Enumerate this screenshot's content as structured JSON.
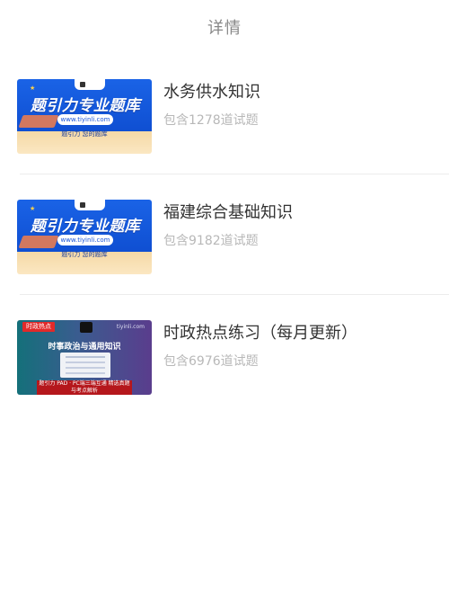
{
  "header": {
    "title": "详情"
  },
  "items": [
    {
      "name": "水务供水知识",
      "count": "包含1278道试题",
      "thumb": {
        "type": "blue",
        "banner": "题引力专业题库",
        "url": "www.tiyinli.com",
        "slogan": "题引力 您的题库"
      }
    },
    {
      "name": "福建综合基础知识",
      "count": "包含9182道试题",
      "thumb": {
        "type": "blue",
        "banner": "题引力专业题库",
        "url": "www.tiyinli.com",
        "slogan": "题引力 您的题库"
      }
    },
    {
      "name": "时政热点练习（每月更新）",
      "count": "包含6976道试题",
      "thumb": {
        "type": "purple",
        "tag": "时政热点",
        "site": "tiyinli.com",
        "heading": "时事政治与通用知识",
        "bottom": "题引力 PAD · PC端三端互通 精选真题与考点解析"
      }
    }
  ],
  "colors": {
    "title": "#888888",
    "name": "#333333",
    "count": "#b8b8b8",
    "divider": "#ececec",
    "brand_blue": "#1a63e6"
  }
}
